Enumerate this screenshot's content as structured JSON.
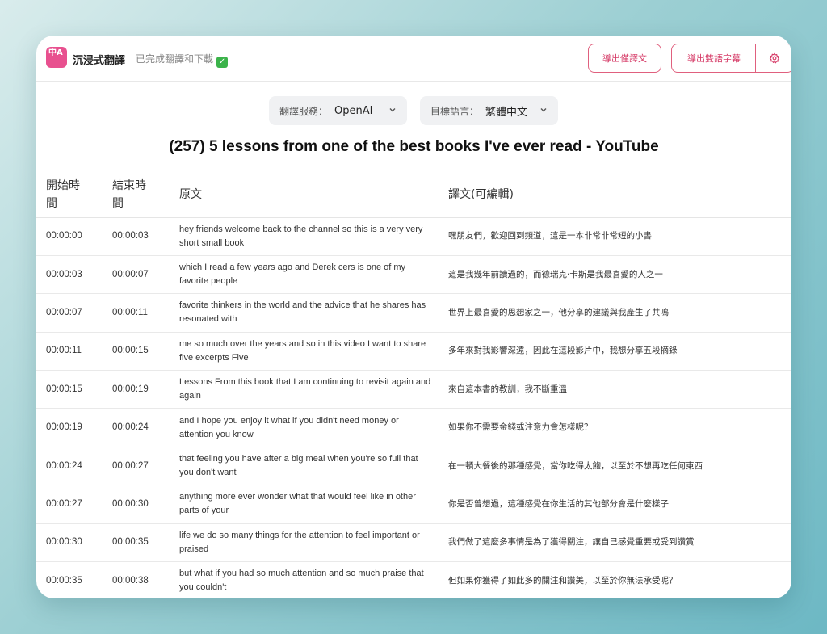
{
  "app": {
    "logo_text": "中A",
    "title": "沉浸式翻譯",
    "status": "已完成翻譯和下載"
  },
  "toolbar": {
    "export_translation": "導出僅譯文",
    "export_bilingual": "導出雙語字幕",
    "settings_icon": "gear-icon"
  },
  "controls": {
    "service_label": "翻譯服務：",
    "service_value": "OpenAI",
    "language_label": "目標語言：",
    "language_value": "繁體中文"
  },
  "page_title": "(257) 5 lessons from one of the best books I've ever read - YouTube",
  "table": {
    "headers": [
      "開始時間",
      "結束時間",
      "原文",
      "譯文(可編輯)"
    ],
    "rows": [
      {
        "start": "00:00:00",
        "end": "00:00:03",
        "source": "hey friends welcome back to the channel so this is a very very short small book",
        "translation": "嘿朋友們，歡迎回到頻道，這是一本非常非常短的小書"
      },
      {
        "start": "00:00:03",
        "end": "00:00:07",
        "source": "which I read a few years ago and Derek cers is one of my favorite people",
        "translation": "這是我幾年前讀過的，而德瑞克·卡斯是我最喜愛的人之一"
      },
      {
        "start": "00:00:07",
        "end": "00:00:11",
        "source": "favorite thinkers in the world and the advice that he shares has resonated with",
        "translation": "世界上最喜愛的思想家之一，他分享的建議與我產生了共鳴"
      },
      {
        "start": "00:00:11",
        "end": "00:00:15",
        "source": "me so much over the years and so in this video I want to share five excerpts Five",
        "translation": "多年來對我影響深遠，因此在這段影片中，我想分享五段摘錄"
      },
      {
        "start": "00:00:15",
        "end": "00:00:19",
        "source": "Lessons From this book that I am continuing to revisit again and again",
        "translation": "來自這本書的教訓，我不斷重溫"
      },
      {
        "start": "00:00:19",
        "end": "00:00:24",
        "source": "and I hope you enjoy it what if you didn't need money or attention you know",
        "translation": "如果你不需要金錢或注意力會怎樣呢？"
      },
      {
        "start": "00:00:24",
        "end": "00:00:27",
        "source": "that feeling you have after a big meal when you're so full that you don't want",
        "translation": "在一頓大餐後的那種感覺，當你吃得太飽，以至於不想再吃任何東西"
      },
      {
        "start": "00:00:27",
        "end": "00:00:30",
        "source": "anything more ever wonder what that would feel like in other parts of your",
        "translation": "你是否曾想過，這種感覺在你生活的其他部分會是什麼樣子"
      },
      {
        "start": "00:00:30",
        "end": "00:00:35",
        "source": "life we do so many things for the attention to feel important or praised",
        "translation": "我們做了這麼多事情是為了獲得關注，讓自己感覺重要或受到讚賞"
      },
      {
        "start": "00:00:35",
        "end": "00:00:38",
        "source": "but what if you had so much attention and so much praise that you couldn't",
        "translation": "但如果你獲得了如此多的關注和讚美，以至於你無法承受呢？"
      }
    ]
  },
  "colors": {
    "accent": "#d63b67",
    "logo_bg": "#e8508f",
    "check_bg": "#3bb34a"
  }
}
